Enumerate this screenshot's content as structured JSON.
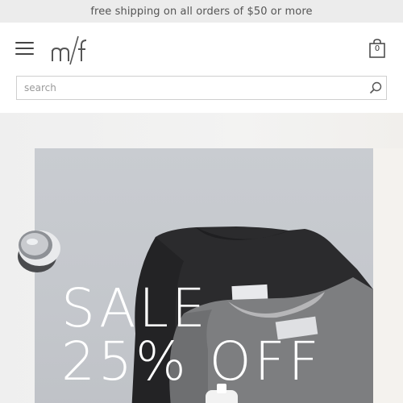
{
  "promo": {
    "text": "free shipping on all orders of $50 or more"
  },
  "header": {
    "menu_icon": "hamburger-menu-icon",
    "logo": "m/f",
    "cart": {
      "icon": "shopping-bag-icon",
      "count": "0"
    }
  },
  "search": {
    "placeholder": "search",
    "value": "",
    "icon": "search-icon"
  },
  "hero": {
    "headline_line1": "SALE",
    "headline_line2": "25% OFF"
  },
  "colors": {
    "promo_bg": "#ececec",
    "hero_bg": "#c7cacf",
    "sweatshirt_black": "#2a2a2c",
    "sweatshirt_gray": "#7b7c7e"
  }
}
